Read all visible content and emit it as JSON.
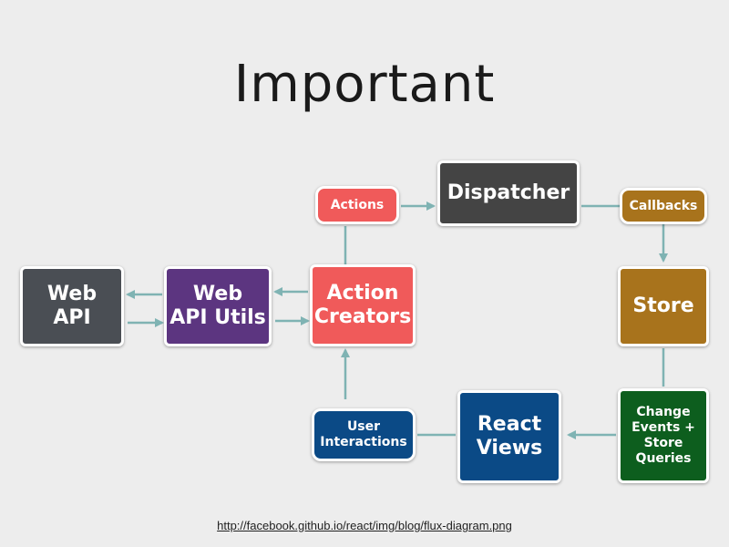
{
  "slide": {
    "title": "Important",
    "source_link": "http://facebook.github.io/react/img/blog/flux-diagram.png"
  },
  "colors": {
    "background": "#ededed",
    "arrow": "#7fb3b3",
    "dispatcher": "#444444",
    "callbacks": "#a8731c",
    "store": "#a8731c",
    "action_creators": "#f05a5a",
    "actions": "#f05a5a",
    "web_api_utils": "#5c3580",
    "web_api": "#4a4e54",
    "react_views": "#0b4a86",
    "user_interactions": "#0b4a86",
    "change_events": "#0d5e1e"
  },
  "diagram": {
    "nodes": {
      "actions": "Actions",
      "dispatcher": "Dispatcher",
      "callbacks": "Callbacks",
      "store": "Store",
      "change_events": [
        "Change",
        "Events +",
        "Store",
        "Queries"
      ],
      "react_views": [
        "React",
        "Views"
      ],
      "user_interactions": [
        "User",
        "Interactions"
      ],
      "action_creators": [
        "Action",
        "Creators"
      ],
      "web_api_utils": [
        "Web",
        "API Utils"
      ],
      "web_api": [
        "Web",
        "API"
      ]
    }
  }
}
